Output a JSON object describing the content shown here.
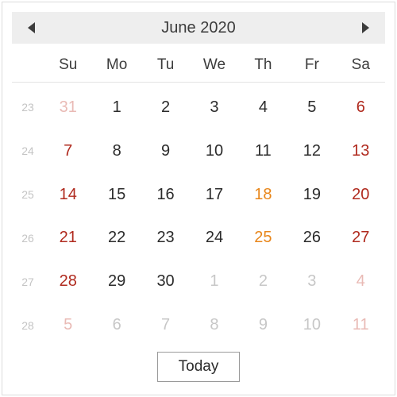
{
  "header": {
    "title": "June 2020",
    "prev_icon": "chevron-left",
    "next_icon": "chevron-right"
  },
  "dow": [
    "Su",
    "Mo",
    "Tu",
    "We",
    "Th",
    "Fr",
    "Sa"
  ],
  "weeks": [
    {
      "wk": "23",
      "days": [
        {
          "n": "31",
          "cls": "c-out-sun"
        },
        {
          "n": "1",
          "cls": "c-normal"
        },
        {
          "n": "2",
          "cls": "c-normal"
        },
        {
          "n": "3",
          "cls": "c-normal"
        },
        {
          "n": "4",
          "cls": "c-normal"
        },
        {
          "n": "5",
          "cls": "c-normal"
        },
        {
          "n": "6",
          "cls": "c-sat"
        }
      ]
    },
    {
      "wk": "24",
      "days": [
        {
          "n": "7",
          "cls": "c-sun"
        },
        {
          "n": "8",
          "cls": "c-normal"
        },
        {
          "n": "9",
          "cls": "c-normal"
        },
        {
          "n": "10",
          "cls": "c-normal"
        },
        {
          "n": "11",
          "cls": "c-normal"
        },
        {
          "n": "12",
          "cls": "c-normal"
        },
        {
          "n": "13",
          "cls": "c-sat"
        }
      ]
    },
    {
      "wk": "25",
      "days": [
        {
          "n": "14",
          "cls": "c-sun"
        },
        {
          "n": "15",
          "cls": "c-normal"
        },
        {
          "n": "16",
          "cls": "c-normal"
        },
        {
          "n": "17",
          "cls": "c-normal"
        },
        {
          "n": "18",
          "cls": "c-hol"
        },
        {
          "n": "19",
          "cls": "c-normal"
        },
        {
          "n": "20",
          "cls": "c-sat"
        }
      ]
    },
    {
      "wk": "26",
      "days": [
        {
          "n": "21",
          "cls": "c-sun"
        },
        {
          "n": "22",
          "cls": "c-normal"
        },
        {
          "n": "23",
          "cls": "c-normal"
        },
        {
          "n": "24",
          "cls": "c-normal"
        },
        {
          "n": "25",
          "cls": "c-hol"
        },
        {
          "n": "26",
          "cls": "c-normal"
        },
        {
          "n": "27",
          "cls": "c-sat"
        }
      ]
    },
    {
      "wk": "27",
      "days": [
        {
          "n": "28",
          "cls": "c-sun"
        },
        {
          "n": "29",
          "cls": "c-normal"
        },
        {
          "n": "30",
          "cls": "c-normal"
        },
        {
          "n": "1",
          "cls": "c-out"
        },
        {
          "n": "2",
          "cls": "c-out"
        },
        {
          "n": "3",
          "cls": "c-out"
        },
        {
          "n": "4",
          "cls": "c-out-sat"
        }
      ]
    },
    {
      "wk": "28",
      "days": [
        {
          "n": "5",
          "cls": "c-out-sun"
        },
        {
          "n": "6",
          "cls": "c-out"
        },
        {
          "n": "7",
          "cls": "c-out"
        },
        {
          "n": "8",
          "cls": "c-out"
        },
        {
          "n": "9",
          "cls": "c-out"
        },
        {
          "n": "10",
          "cls": "c-out"
        },
        {
          "n": "11",
          "cls": "c-out-sat"
        }
      ]
    }
  ],
  "footer": {
    "today_label": "Today"
  }
}
